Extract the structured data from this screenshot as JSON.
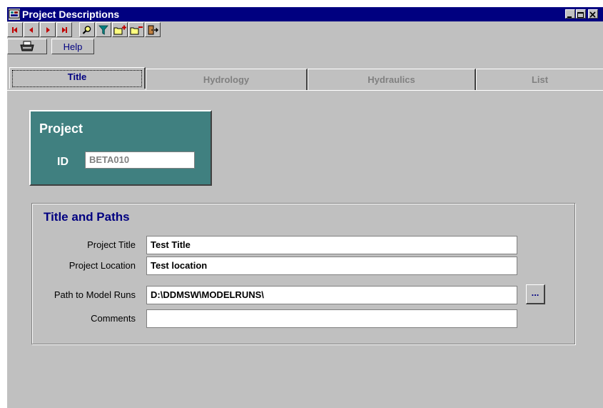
{
  "window": {
    "title": "Project Descriptions"
  },
  "toolbar": {
    "buttons": [
      {
        "icon": "first-record-icon"
      },
      {
        "icon": "previous-record-icon"
      },
      {
        "icon": "next-record-icon"
      },
      {
        "icon": "last-record-icon"
      },
      {
        "icon": "search-icon"
      },
      {
        "icon": "filter-icon"
      },
      {
        "icon": "add-record-icon"
      },
      {
        "icon": "delete-record-icon"
      },
      {
        "icon": "exit-icon"
      }
    ],
    "print_icon": "printer-icon",
    "help_label": "Help"
  },
  "tabs": [
    {
      "label": "Title",
      "active": true
    },
    {
      "label": "Hydrology",
      "active": false
    },
    {
      "label": "Hydraulics",
      "active": false
    },
    {
      "label": "List",
      "active": false
    }
  ],
  "project": {
    "heading": "Project",
    "id_label": "ID",
    "id_value": "BETA010"
  },
  "paths": {
    "heading": "Title and Paths",
    "fields": [
      {
        "label": "Project Title",
        "value": "Test Title"
      },
      {
        "label": "Project Location",
        "value": "Test location"
      },
      {
        "label": "Path to Model Runs",
        "value": "D:\\DDMSW\\MODELRUNS\\"
      },
      {
        "label": "Comments",
        "value": ""
      }
    ],
    "browse_label": "..."
  },
  "colors": {
    "titlebar": "#000080",
    "project_panel": "#408080",
    "window_bg": "#c0c0c0",
    "accent_text": "#000080"
  }
}
